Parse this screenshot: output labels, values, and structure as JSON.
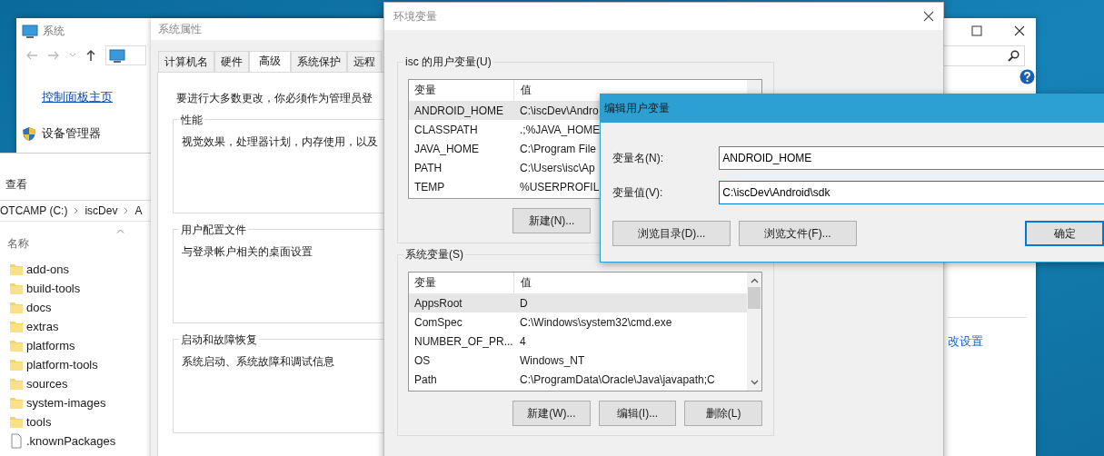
{
  "system_window": {
    "title": "系统",
    "sidebar_links": [
      {
        "text": "控制面板主页",
        "kind": "link"
      },
      {
        "text": "设备管理器",
        "kind": "shield"
      }
    ],
    "right_link": "改设置"
  },
  "explorer": {
    "ribbon_tab": "查看",
    "breadcrumb": [
      "OTCAMP (C:)",
      "iscDev",
      "A"
    ],
    "column": "名称",
    "items": [
      {
        "name": "add-ons",
        "kind": "folder"
      },
      {
        "name": "build-tools",
        "kind": "folder"
      },
      {
        "name": "docs",
        "kind": "folder"
      },
      {
        "name": "extras",
        "kind": "folder"
      },
      {
        "name": "platforms",
        "kind": "folder"
      },
      {
        "name": "platform-tools",
        "kind": "folder"
      },
      {
        "name": "sources",
        "kind": "folder"
      },
      {
        "name": "system-images",
        "kind": "folder"
      },
      {
        "name": "tools",
        "kind": "folder"
      },
      {
        "name": ".knownPackages",
        "kind": "file"
      }
    ]
  },
  "system_properties": {
    "title": "系统属性",
    "tabs": [
      {
        "label": "计算机名",
        "selected": false
      },
      {
        "label": "硬件",
        "selected": false
      },
      {
        "label": "高级",
        "selected": true
      },
      {
        "label": "系统保护",
        "selected": false
      },
      {
        "label": "远程",
        "selected": false
      }
    ],
    "notice": "要进行大多数更改，你必须作为管理员登",
    "groups": [
      {
        "title": "性能",
        "text": "视觉效果，处理器计划，内存使用，以及"
      },
      {
        "title": "用户配置文件",
        "text": "与登录帐户相关的桌面设置"
      },
      {
        "title": "启动和故障恢复",
        "text": "系统启动、系统故障和调试信息"
      }
    ]
  },
  "environment_variables": {
    "title": "环境变量",
    "groups": [
      {
        "title": "isc 的用户变量(U)",
        "columns": [
          "变量",
          "值"
        ],
        "rows": [
          {
            "variable": "ANDROID_HOME",
            "value": "C:\\iscDev\\Andro",
            "selected": true
          },
          {
            "variable": "CLASSPATH",
            "value": ".;%JAVA_HOME",
            "selected": false
          },
          {
            "variable": "JAVA_HOME",
            "value": "C:\\Program File",
            "selected": false
          },
          {
            "variable": "PATH",
            "value": "C:\\Users\\isc\\Ap",
            "selected": false
          },
          {
            "variable": "TEMP",
            "value": "%USERPROFIL",
            "selected": false
          }
        ],
        "buttons": [
          "新建(N)..."
        ]
      },
      {
        "title": "系统变量(S)",
        "columns": [
          "变量",
          "值"
        ],
        "rows": [
          {
            "variable": "AppsRoot",
            "value": "D",
            "selected": true
          },
          {
            "variable": "ComSpec",
            "value": "C:\\Windows\\system32\\cmd.exe",
            "selected": false
          },
          {
            "variable": "NUMBER_OF_PR...",
            "value": "4",
            "selected": false
          },
          {
            "variable": "OS",
            "value": "Windows_NT",
            "selected": false
          },
          {
            "variable": "Path",
            "value": "C:\\ProgramData\\Oracle\\Java\\javapath;C",
            "selected": false
          }
        ],
        "buttons": [
          "新建(W)...",
          "编辑(I)...",
          "删除(L)"
        ]
      }
    ]
  },
  "edit_dialog": {
    "title": "编辑用户变量",
    "fields": [
      {
        "label": "变量名(N):",
        "value": "ANDROID_HOME",
        "focused": false
      },
      {
        "label": "变量值(V):",
        "value": "C:\\iscDev\\Android\\sdk",
        "focused": true
      }
    ],
    "buttons": [
      {
        "label": "浏览目录(D)...",
        "default": false
      },
      {
        "label": "浏览文件(F)...",
        "default": false
      },
      {
        "label": "确定",
        "default": true
      }
    ]
  }
}
